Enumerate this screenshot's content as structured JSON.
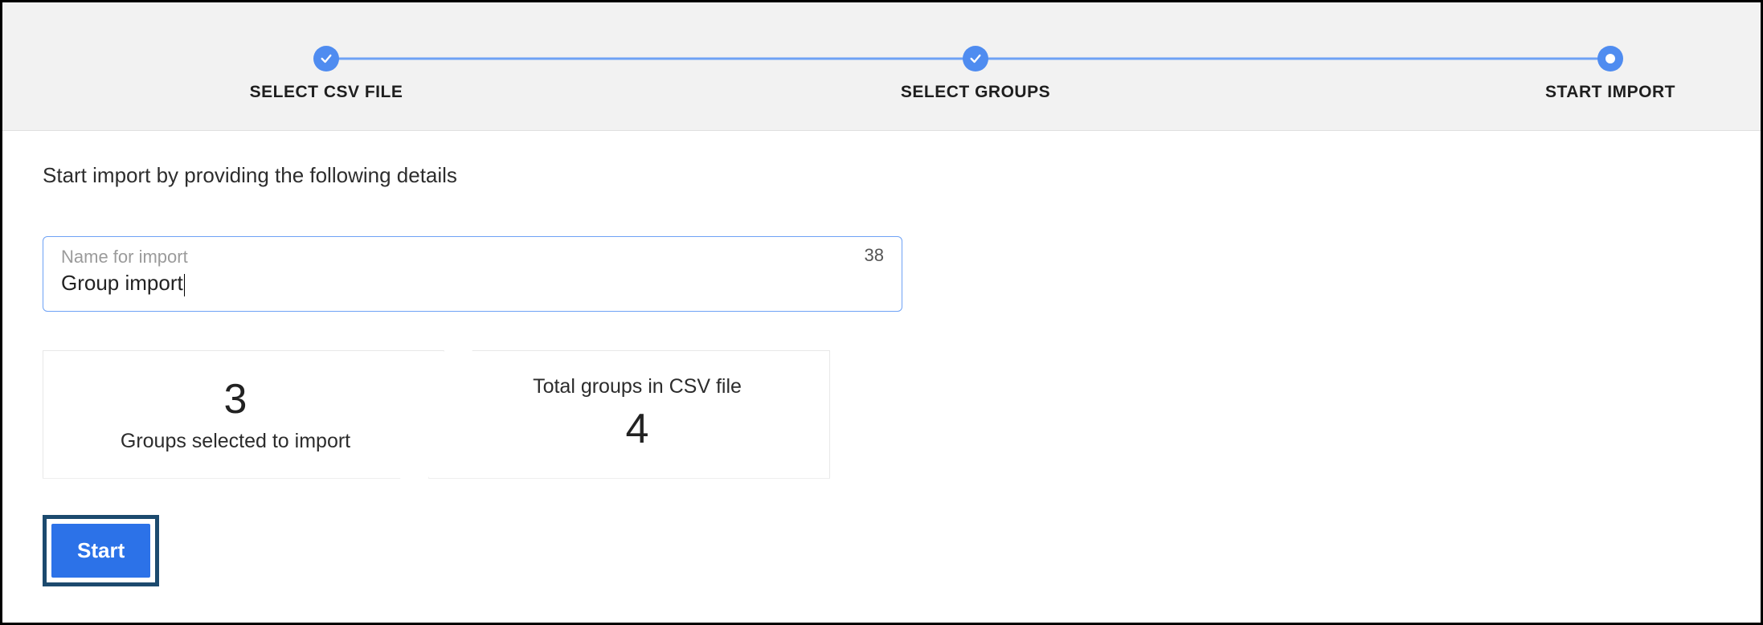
{
  "stepper": {
    "steps": [
      {
        "label": "SELECT CSV FILE",
        "state": "done"
      },
      {
        "label": "SELECT GROUPS",
        "state": "done"
      },
      {
        "label": "START IMPORT",
        "state": "current"
      }
    ]
  },
  "main": {
    "instruction": "Start import by providing the following details",
    "name_field": {
      "label": "Name for import",
      "value": "Group import",
      "char_remaining": "38"
    },
    "stats": {
      "selected": {
        "value": "3",
        "caption": "Groups selected to import"
      },
      "total": {
        "caption": "Total groups in CSV file",
        "value": "4"
      }
    },
    "start_button": "Start"
  },
  "colors": {
    "accent_blue": "#4f8cf0",
    "line_blue": "#6ea2f5",
    "button_blue": "#2c72e8",
    "outline_dark": "#1c4a6e"
  }
}
